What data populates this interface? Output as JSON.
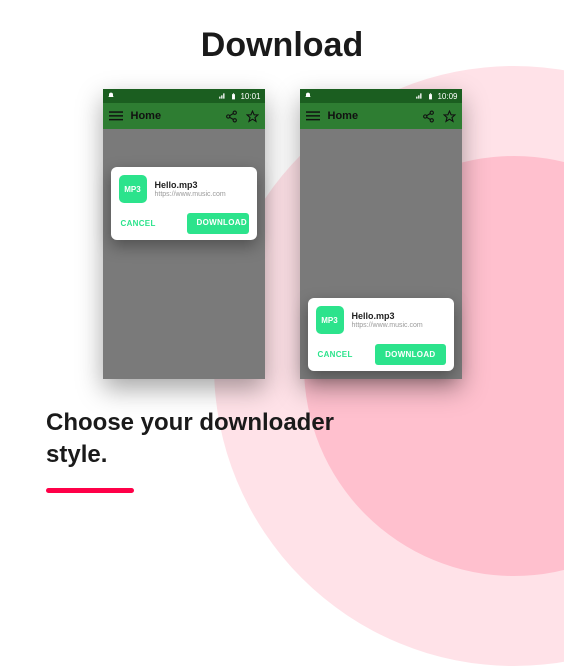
{
  "page_title": "Download",
  "caption_line1": "Choose your downloader",
  "caption_line2": "style.",
  "left_phone": {
    "time": "10:01",
    "toolbar_title": "Home",
    "file_badge": "MP3",
    "file_name": "Hello.mp3",
    "file_url": "https://www.music.com",
    "cancel_label": "CANCEL",
    "download_label": "DOWNLOAD"
  },
  "right_phone": {
    "time": "10:09",
    "toolbar_title": "Home",
    "file_badge": "MP3",
    "file_name": "Hello.mp3",
    "file_url": "https://www.music.com",
    "cancel_label": "CANCEL",
    "download_label": "DOWNLOAD"
  }
}
